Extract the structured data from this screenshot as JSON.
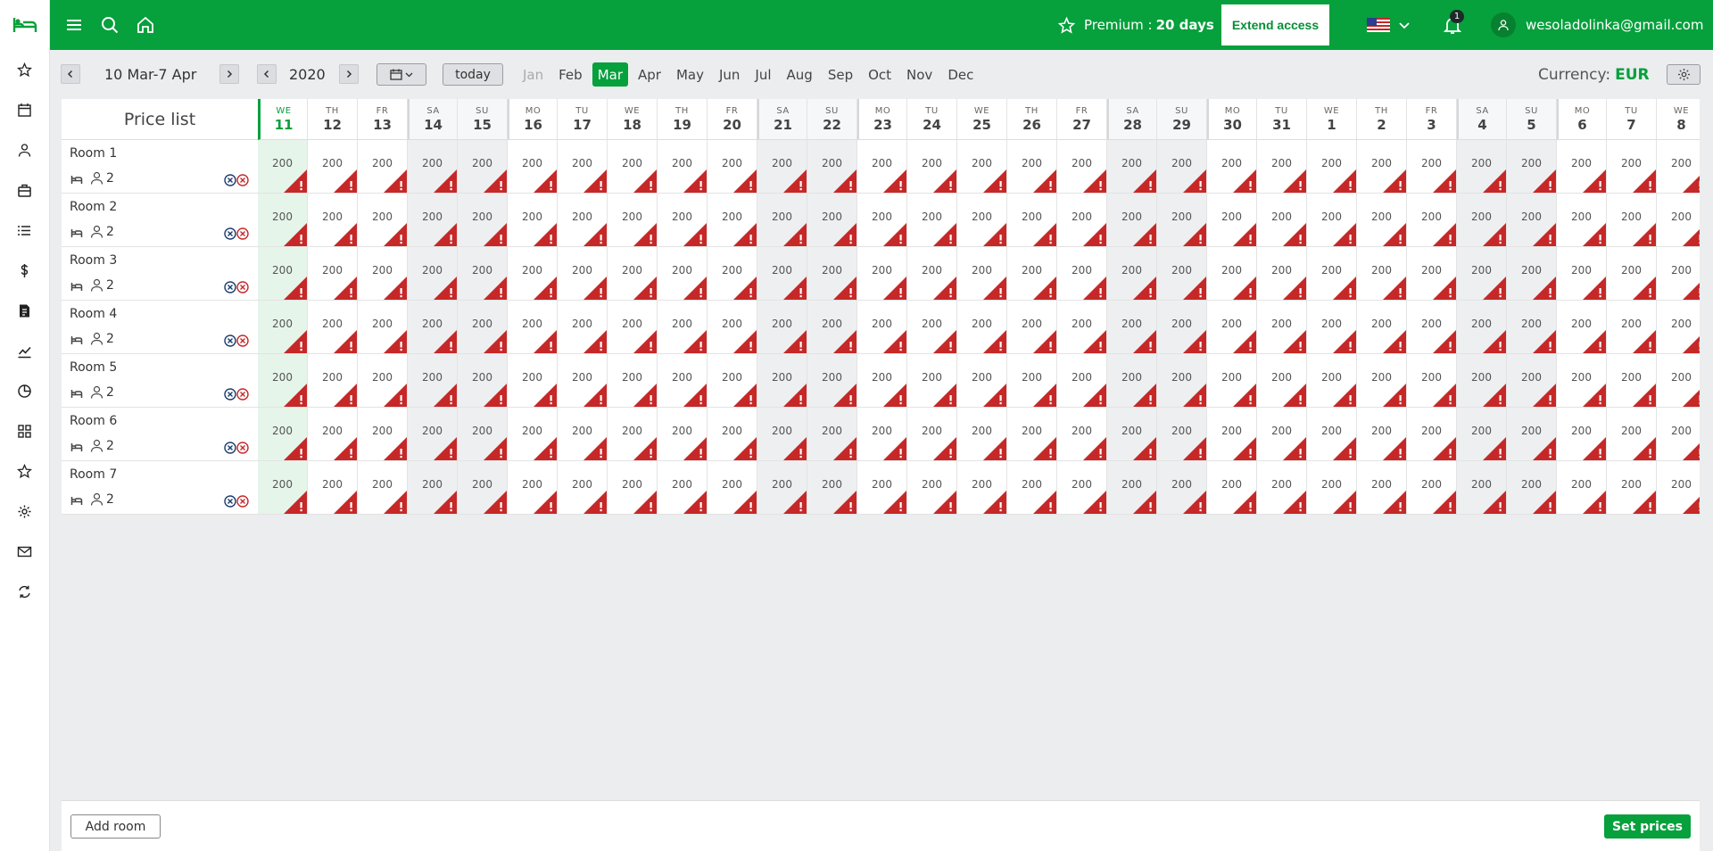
{
  "app": {
    "accent": "#06a03c",
    "logo_icon": "bed-icon"
  },
  "sidebar": {
    "items": [
      {
        "name": "favorites",
        "icon": "star-icon"
      },
      {
        "name": "calendar",
        "icon": "calendar-icon"
      },
      {
        "name": "guests",
        "icon": "user-icon"
      },
      {
        "name": "bookings",
        "icon": "briefcase-icon"
      },
      {
        "name": "list",
        "icon": "list-icon"
      },
      {
        "name": "pricing",
        "icon": "dollar-icon"
      },
      {
        "name": "invoices",
        "icon": "invoice-icon"
      },
      {
        "name": "statistics",
        "icon": "chart-icon"
      },
      {
        "name": "reports",
        "icon": "pie-icon"
      },
      {
        "name": "modules",
        "icon": "grid-icon"
      },
      {
        "name": "reviews",
        "icon": "star-icon"
      },
      {
        "name": "settings",
        "icon": "gear-icon"
      },
      {
        "name": "messages",
        "icon": "mail-icon"
      },
      {
        "name": "sync",
        "icon": "sync-icon"
      }
    ]
  },
  "topbar": {
    "premium_label": "Premium : ",
    "premium_days": "20 days",
    "extend_label": "Extend access",
    "notifications": "1",
    "user_email": "wesoladolinka@gmail.com"
  },
  "toolbar": {
    "date_range": "10 Mar-7 Apr",
    "year": "2020",
    "today_label": "today",
    "months": [
      {
        "label": "Jan",
        "state": "disabled"
      },
      {
        "label": "Feb",
        "state": "normal"
      },
      {
        "label": "Mar",
        "state": "active"
      },
      {
        "label": "Apr",
        "state": "normal"
      },
      {
        "label": "May",
        "state": "normal"
      },
      {
        "label": "Jun",
        "state": "normal"
      },
      {
        "label": "Jul",
        "state": "normal"
      },
      {
        "label": "Aug",
        "state": "normal"
      },
      {
        "label": "Sep",
        "state": "normal"
      },
      {
        "label": "Oct",
        "state": "normal"
      },
      {
        "label": "Nov",
        "state": "normal"
      },
      {
        "label": "Dec",
        "state": "normal"
      }
    ],
    "currency_label": "Currency:",
    "currency_value": "EUR"
  },
  "grid": {
    "title": "Price list",
    "days": [
      {
        "dow": "WE",
        "dom": "11",
        "today": true
      },
      {
        "dow": "TH",
        "dom": "12"
      },
      {
        "dow": "FR",
        "dom": "13"
      },
      {
        "dow": "SA",
        "dom": "14",
        "weekend": true
      },
      {
        "dow": "SU",
        "dom": "15",
        "weekend": true
      },
      {
        "dow": "MO",
        "dom": "16"
      },
      {
        "dow": "TU",
        "dom": "17"
      },
      {
        "dow": "WE",
        "dom": "18"
      },
      {
        "dow": "TH",
        "dom": "19"
      },
      {
        "dow": "FR",
        "dom": "20"
      },
      {
        "dow": "SA",
        "dom": "21",
        "weekend": true
      },
      {
        "dow": "SU",
        "dom": "22",
        "weekend": true
      },
      {
        "dow": "MO",
        "dom": "23"
      },
      {
        "dow": "TU",
        "dom": "24"
      },
      {
        "dow": "WE",
        "dom": "25"
      },
      {
        "dow": "TH",
        "dom": "26"
      },
      {
        "dow": "FR",
        "dom": "27"
      },
      {
        "dow": "SA",
        "dom": "28",
        "weekend": true
      },
      {
        "dow": "SU",
        "dom": "29",
        "weekend": true
      },
      {
        "dow": "MO",
        "dom": "30"
      },
      {
        "dow": "TU",
        "dom": "31"
      },
      {
        "dow": "WE",
        "dom": "1"
      },
      {
        "dow": "TH",
        "dom": "2"
      },
      {
        "dow": "FR",
        "dom": "3"
      },
      {
        "dow": "SA",
        "dom": "4",
        "weekend": true
      },
      {
        "dow": "SU",
        "dom": "5",
        "weekend": true
      },
      {
        "dow": "MO",
        "dom": "6"
      },
      {
        "dow": "TU",
        "dom": "7"
      },
      {
        "dow": "WE",
        "dom": "8"
      }
    ],
    "rooms": [
      {
        "name": "Room 1",
        "capacity": "2"
      },
      {
        "name": "Room 2",
        "capacity": "2"
      },
      {
        "name": "Room 3",
        "capacity": "2"
      },
      {
        "name": "Room 4",
        "capacity": "2"
      },
      {
        "name": "Room 5",
        "capacity": "2"
      },
      {
        "name": "Room 6",
        "capacity": "2"
      },
      {
        "name": "Room 7",
        "capacity": "2"
      }
    ],
    "price": "200",
    "warning_color": "#c62828"
  },
  "footer": {
    "add_room_label": "Add room",
    "set_prices_label": "Set prices"
  }
}
